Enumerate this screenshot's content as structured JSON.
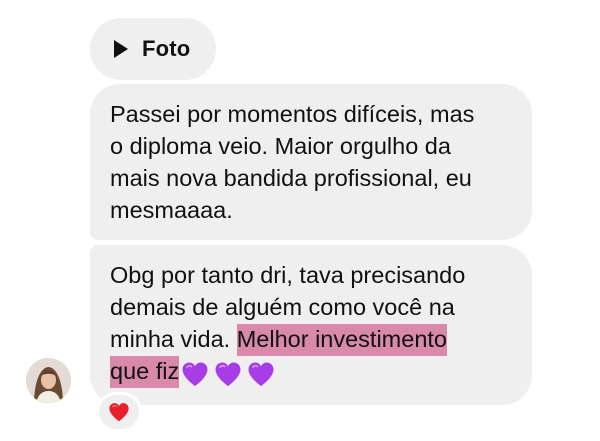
{
  "messages": {
    "photo": {
      "label": "Foto",
      "icon": "play-icon"
    },
    "message_1": {
      "lines": [
        "Passei por momentos difíceis, mas",
        "o diploma veio. Maior orgulho da",
        "mais nova bandida profissional, eu",
        "mesmaaaa."
      ]
    },
    "message_2": {
      "lines": [
        "Obg por tanto dri, tava precisando",
        "demais de alguém como você na"
      ],
      "line3_plain": "minha vida. ",
      "line3_highlight": "Melhor investimento",
      "line4_highlight": "que fiz",
      "hearts": [
        "purple-heart-icon",
        "purple-heart-icon",
        "purple-heart-icon"
      ]
    }
  },
  "reaction": {
    "emoji": "red-heart-icon"
  },
  "avatar": {
    "icon": "avatar"
  },
  "colors": {
    "bubble": "#efefef",
    "highlight": "#d98aa8",
    "purple_heart": "#a63de6",
    "red_heart": "#e8202b"
  }
}
